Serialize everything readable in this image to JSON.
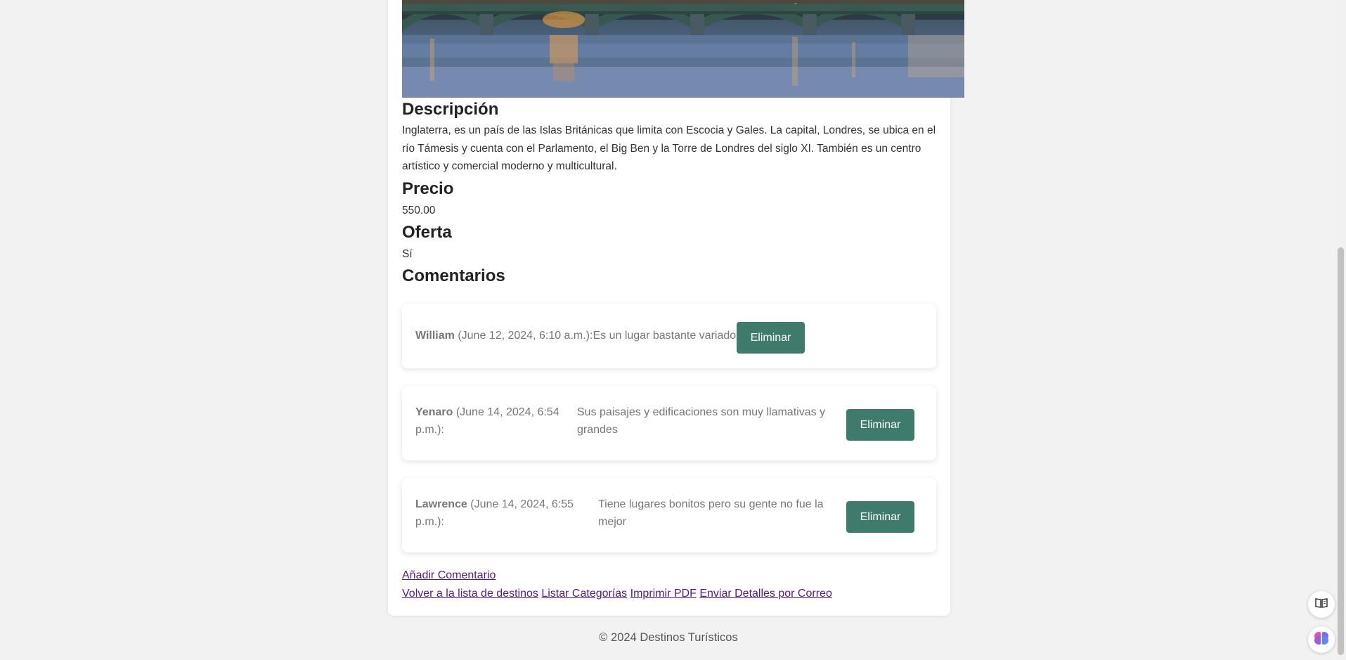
{
  "sections": {
    "description_title": "Descripción",
    "description_text": "Inglaterra, es un país de las Islas Británicas que limita con Escocia y Gales. La capital, Londres, se ubica en el río Támesis y cuenta con el Parlamento, el Big Ben y la Torre de Londres del siglo XI. También es un centro artístico y comercial moderno y multicultural.",
    "price_title": "Precio",
    "price_value": "550.00",
    "offer_title": "Oferta",
    "offer_value": "Sí",
    "comments_title": "Comentarios"
  },
  "comments": [
    {
      "author": "William",
      "date": "(June 12, 2024, 6:10 a.m.):",
      "text": "Es un lugar bastante variado",
      "delete_label": "Eliminar"
    },
    {
      "author": "Yenaro",
      "date": "(June 14, 2024, 6:54 p.m.):",
      "text": "Sus paisajes y edificaciones son muy llamativas y grandes",
      "delete_label": "Eliminar"
    },
    {
      "author": "Lawrence",
      "date": "(June 14, 2024, 6:55 p.m.):",
      "text": "Tiene lugares bonitos pero su gente no fue la mejor",
      "delete_label": "Eliminar"
    }
  ],
  "links": {
    "add_comment": "Añadir Comentario",
    "back_to_list": "Volver a la lista de destinos",
    "list_categories": "Listar Categorías",
    "print_pdf": "Imprimir PDF",
    "send_email": "Enviar Detalles por Correo"
  },
  "footer": {
    "text": "© 2024 Destinos Turísticos"
  },
  "floating": {
    "reader_icon": "book-open-icon",
    "assistant_icon": "brain-icon"
  },
  "colors": {
    "button_bg": "#3f7b6d",
    "link": "#551a8b",
    "page_bg": "#f2f2f2"
  }
}
